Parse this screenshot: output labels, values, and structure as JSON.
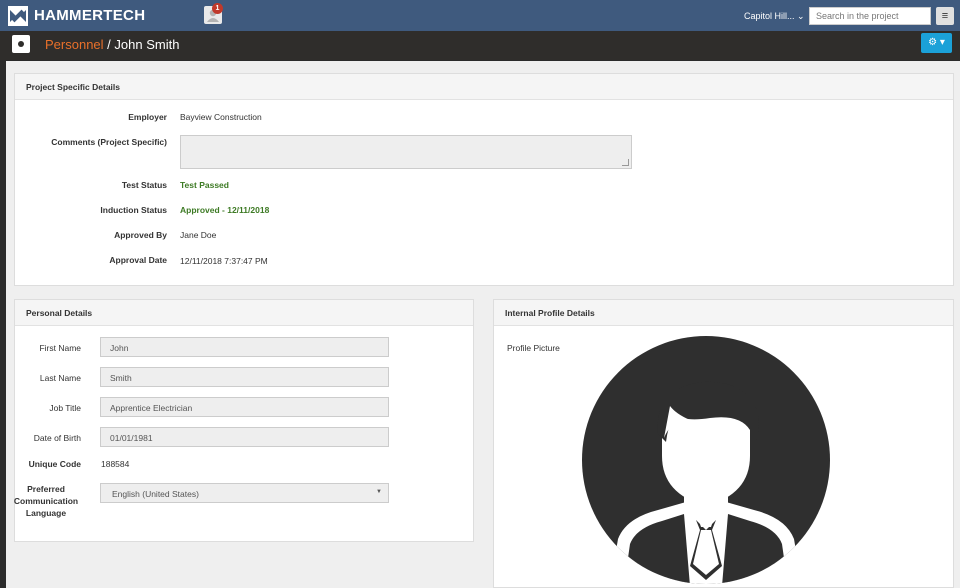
{
  "topbar": {
    "brand": "HAMMERTECH",
    "notification_count": "1",
    "project_selector": "Capitol Hill... ⌄",
    "search_placeholder": "Search in the project",
    "menu_glyph": "≡"
  },
  "breadcrumb": {
    "parent": "Personnel",
    "separator": " / ",
    "current": "John Smith"
  },
  "gear_label": "⚙ ▾",
  "project_details": {
    "title": "Project Specific Details",
    "rows": [
      {
        "label": "Employer",
        "value": "Bayview Construction"
      },
      {
        "label": "Comments (Project Specific)",
        "value": ""
      },
      {
        "label": "Test Status",
        "value": "Test Passed"
      },
      {
        "label": "Induction Status",
        "value": "Approved - 12/11/2018"
      },
      {
        "label": "Approved By",
        "value": "Jane Doe"
      },
      {
        "label": "Approval Date",
        "value": "12/11/2018 7:37:47 PM"
      }
    ]
  },
  "personal_details": {
    "title": "Personal Details",
    "first_name": {
      "label": "First Name",
      "value": "John"
    },
    "last_name": {
      "label": "Last Name",
      "value": "Smith"
    },
    "job_title": {
      "label": "Job Title",
      "value": "Apprentice Electrician"
    },
    "dob": {
      "label": "Date of Birth",
      "value": "01/01/1981"
    },
    "unique_code": {
      "label": "Unique Code",
      "value": "188584"
    },
    "language": {
      "label_lines": [
        "Preferred",
        "Communication",
        "Language"
      ],
      "value": "English (United States)"
    }
  },
  "internal_profile": {
    "title": "Internal Profile Details",
    "picture_label": "Profile Picture"
  },
  "colors": {
    "topbar": "#3f5a7e",
    "accent_orange": "#e8702a",
    "accent_blue": "#1ba1d8",
    "status_green": "#3d7a24"
  }
}
